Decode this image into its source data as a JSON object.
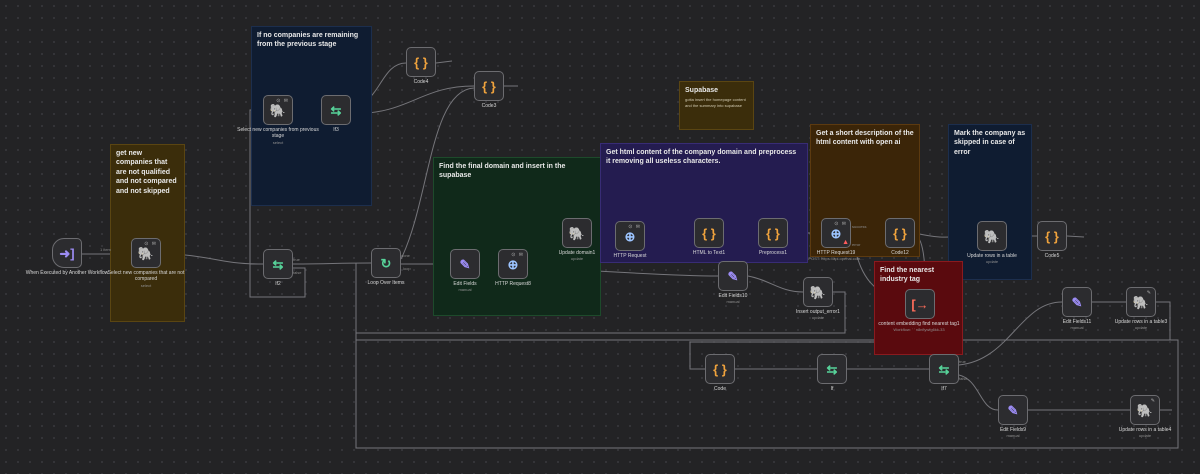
{
  "stickies": [
    {
      "id": "no-companies",
      "text": "If no companies are remaining from the previous stage",
      "sub": "",
      "bg": "#0f1c31",
      "border": "#1c2e4d"
    },
    {
      "id": "get-new",
      "text": "get new\ncompanies that\nare not qualified\nand not compared\nand not skipped",
      "sub": "",
      "bg": "#3b2d0b",
      "border": "#5a4512"
    },
    {
      "id": "supabase",
      "text": "Supabase",
      "sub": "gotta insert the homepage content and the summary into supabase",
      "bg": "#3b2d0b",
      "border": "#5a4512"
    },
    {
      "id": "final-domain",
      "text": "Find the final domain and insert in the supabase",
      "sub": "",
      "bg": "#10291a",
      "border": "#1d4a2b"
    },
    {
      "id": "html-content",
      "text": "Get html content of the company domain and preprocess it removing all useless characters.",
      "sub": "",
      "bg": "#241c50",
      "border": "#382c75"
    },
    {
      "id": "short-desc",
      "text": "Get a short description of the html content with open ai",
      "sub": "",
      "bg": "#3b2508",
      "border": "#5c3a10"
    },
    {
      "id": "skipped",
      "text": "Mark the company as skipped in case of error",
      "sub": "",
      "bg": "#0f1c31",
      "border": "#1c2e4d"
    },
    {
      "id": "industry-tag",
      "text": "Find the nearest industry tag",
      "sub": "",
      "bg": "#5a0a0e",
      "border": "#8a1a1e"
    }
  ],
  "nodes": [
    {
      "id": "trigger",
      "name": "When Executed by Another Workflow",
      "sub": "",
      "icon": "➜]",
      "color": "c-purple",
      "badge": ""
    },
    {
      "id": "select-new",
      "name": "Select new companies that are not compared",
      "sub": "select",
      "icon": "🐘",
      "color": "c-teal",
      "badge": "⊙ ✉"
    },
    {
      "id": "select-prev",
      "name": "Select new companies from previous stage",
      "sub": "select",
      "icon": "🐘",
      "color": "c-teal",
      "badge": "⊙ ✉"
    },
    {
      "id": "if3",
      "name": "If3",
      "sub": "",
      "icon": "⇆",
      "color": "c-green",
      "badge": ""
    },
    {
      "id": "code4",
      "name": "Code4",
      "sub": "",
      "icon": "{ }",
      "color": "c-orange",
      "badge": ""
    },
    {
      "id": "code3",
      "name": "Code3",
      "sub": "",
      "icon": "{ }",
      "color": "c-orange",
      "badge": ""
    },
    {
      "id": "if2",
      "name": "If2",
      "sub": "",
      "icon": "⇆",
      "color": "c-green",
      "badge": ""
    },
    {
      "id": "loop",
      "name": "Loop Over Items",
      "sub": "",
      "icon": "↻",
      "color": "c-green",
      "badge": ""
    },
    {
      "id": "edit-fields",
      "name": "Edit Fields",
      "sub": "manual",
      "icon": "✎",
      "color": "c-purple",
      "badge": ""
    },
    {
      "id": "http8",
      "name": "HTTP Request8",
      "sub": "",
      "icon": "⊕",
      "color": "c-blue",
      "badge": "⊙ ✉"
    },
    {
      "id": "update-domain",
      "name": "Update domain1",
      "sub": "update",
      "icon": "🐘",
      "color": "c-teal",
      "badge": ""
    },
    {
      "id": "http",
      "name": "HTTP Request",
      "sub": "",
      "icon": "⊕",
      "color": "c-blue",
      "badge": "⊙ ✉"
    },
    {
      "id": "html-text",
      "name": "HTML to Text1",
      "sub": "",
      "icon": "{ }",
      "color": "c-orange",
      "badge": ""
    },
    {
      "id": "preprocess",
      "name": "Preprocess1",
      "sub": "",
      "icon": "{ }",
      "color": "c-orange",
      "badge": ""
    },
    {
      "id": "http19",
      "name": "HTTP Request19",
      "sub": "POST: https://api.openai.com...",
      "icon": "⊕",
      "color": "c-blue",
      "badge": "⊙ ✉",
      "warn": "▲"
    },
    {
      "id": "code12",
      "name": "Code12",
      "sub": "",
      "icon": "{ }",
      "color": "c-orange",
      "badge": ""
    },
    {
      "id": "update-rows",
      "name": "Update rows in a table",
      "sub": "update",
      "icon": "🐘",
      "color": "c-teal",
      "badge": ""
    },
    {
      "id": "code5",
      "name": "Code5",
      "sub": "",
      "icon": "{ }",
      "color": "c-orange",
      "badge": ""
    },
    {
      "id": "edit-fields10",
      "name": "Edit Fields10",
      "sub": "manual",
      "icon": "✎",
      "color": "c-purple",
      "badge": ""
    },
    {
      "id": "insert-output",
      "name": "Insert output_error1",
      "sub": "update",
      "icon": "🐘",
      "color": "c-teal",
      "badge": ""
    },
    {
      "id": "content-embed",
      "name": "content embedding find nearest tag1",
      "sub": "Workflow: ' ' n8nflywfg6kk-33",
      "icon": "[→",
      "color": "c-red",
      "badge": ""
    },
    {
      "id": "edit-fields11",
      "name": "Edit Fields11",
      "sub": "manual",
      "icon": "✎",
      "color": "c-purple",
      "badge": ""
    },
    {
      "id": "update-rows3",
      "name": "Update rows in a table3",
      "sub": "update",
      "icon": "🐘",
      "color": "c-teal",
      "badge": "✎"
    },
    {
      "id": "code",
      "name": "Code",
      "sub": "",
      "icon": "{ }",
      "color": "c-orange",
      "badge": ""
    },
    {
      "id": "if",
      "name": "If",
      "sub": "",
      "icon": "⇆",
      "color": "c-green",
      "badge": ""
    },
    {
      "id": "if7",
      "name": "If7",
      "sub": "",
      "icon": "⇆",
      "color": "c-green",
      "badge": ""
    },
    {
      "id": "edit-fields9",
      "name": "Edit Fields9",
      "sub": "manual",
      "icon": "✎",
      "color": "c-purple",
      "badge": ""
    },
    {
      "id": "update-rows4",
      "name": "Update rows in a table4",
      "sub": "update",
      "icon": "🐘",
      "color": "c-teal",
      "badge": "✎"
    }
  ],
  "connection_labels": {
    "trigger_items": "1 item",
    "loop_done": "done",
    "loop_loop": "loop",
    "if_true": "true",
    "if_false": "false",
    "success": "success",
    "error": "error"
  }
}
